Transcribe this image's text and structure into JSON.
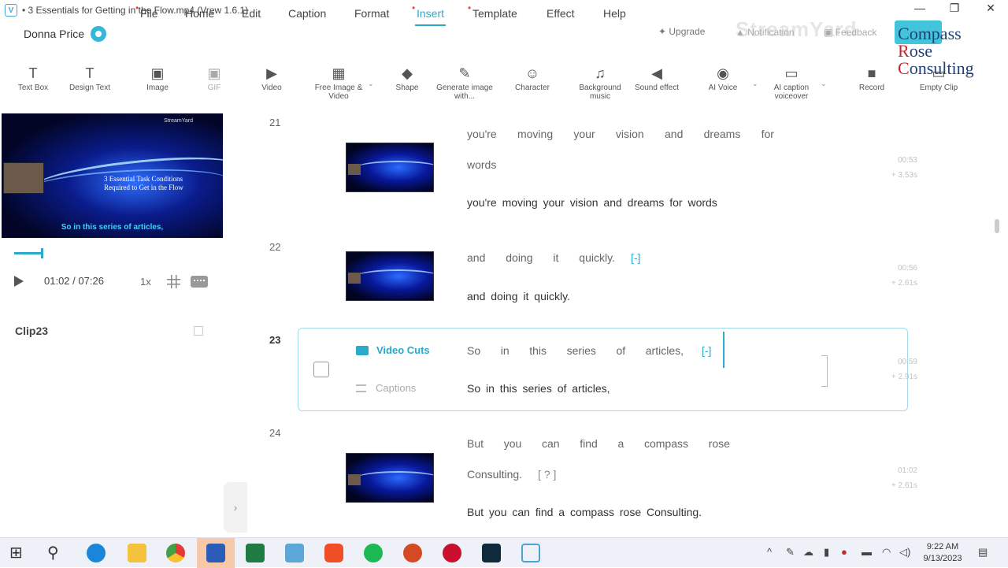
{
  "window": {
    "title": "• 3 Essentials for Getting in the Flow.mp4 (Vrew 1.6.1)",
    "app_icon": "V"
  },
  "menubar": {
    "user": "Donna Price",
    "items": [
      "File",
      "Home",
      "Edit",
      "Caption",
      "Format",
      "Insert",
      "Template",
      "Effect",
      "Help"
    ],
    "upgrade": "Upgrade",
    "notification": "Notification",
    "feedback": "Feedback",
    "watermark": "StreamYard"
  },
  "logo": {
    "line1_initial": "C",
    "line1_rest": "ompass",
    "line2_initial": "R",
    "line2_rest": "ose",
    "line3_initial": "C",
    "line3_rest": "onsulting"
  },
  "toolbar": {
    "tools": [
      {
        "label": "Text Box",
        "icon": "T"
      },
      {
        "label": "Design Text",
        "icon": "T"
      },
      {
        "label": "Image",
        "icon": "▣"
      },
      {
        "label": "GIF",
        "icon": "▣"
      },
      {
        "label": "Video",
        "icon": "▶"
      },
      {
        "label": "Free Image & Video",
        "icon": "▦"
      },
      {
        "label": "Shape",
        "icon": "◆"
      },
      {
        "label": "Generate image with...",
        "icon": "✎"
      },
      {
        "label": "Character",
        "icon": "☺"
      },
      {
        "label": "Background music",
        "icon": "♫"
      },
      {
        "label": "Sound effect",
        "icon": "◀"
      },
      {
        "label": "AI Voice",
        "icon": "◉"
      },
      {
        "label": "AI caption voiceover",
        "icon": "▭"
      },
      {
        "label": "Record",
        "icon": "■"
      },
      {
        "label": "Empty Clip",
        "icon": "▭"
      }
    ]
  },
  "player": {
    "brand": "StreamYard",
    "video_title": "3 Essential Task Conditions Required to Get in the Flow",
    "subtitle": "So in this series of articles,",
    "current_time": "01:02",
    "total_time": "/ 07:26",
    "speed": "1x",
    "progress_fraction": 0.14
  },
  "clip_label": "Clip23",
  "rows": [
    {
      "num": "21",
      "cut_words": [
        "you're",
        "moving",
        "your",
        "vision",
        "and",
        "dreams",
        "for"
      ],
      "cut_words2": "words",
      "caption": "you're moving your vision and dreams for words",
      "start": "00:53",
      "dur": "+ 3.53s"
    },
    {
      "num": "22",
      "cut_words": [
        "and",
        "doing",
        "it",
        "quickly."
      ],
      "bracket": "[-]",
      "caption": "and doing it quickly.",
      "start": "00:56",
      "dur": "+ 2.61s"
    },
    {
      "num": "23",
      "cut_words": [
        "So",
        "in",
        "this",
        "series",
        "of",
        "articles,"
      ],
      "bracket": "[-]",
      "caption": "So in this series of articles,",
      "start": "00:59",
      "dur": "+ 2.91s",
      "video_cuts_label": "Video Cuts",
      "captions_label": "Captions"
    },
    {
      "num": "24",
      "cut_words": [
        "But",
        "you",
        "can",
        "find",
        "a",
        "compass",
        "rose"
      ],
      "cut_words2": "Consulting.",
      "bracket": "[ ? ]",
      "caption": "But you can find a compass rose Consulting.",
      "start": "01:02",
      "dur": "+ 2.61s"
    }
  ],
  "taskbar": {
    "time": "9:22 AM",
    "date": "9/13/2023"
  },
  "colors": {
    "accent": "#2aa9c9",
    "menu_dot": "#e84b3c"
  }
}
